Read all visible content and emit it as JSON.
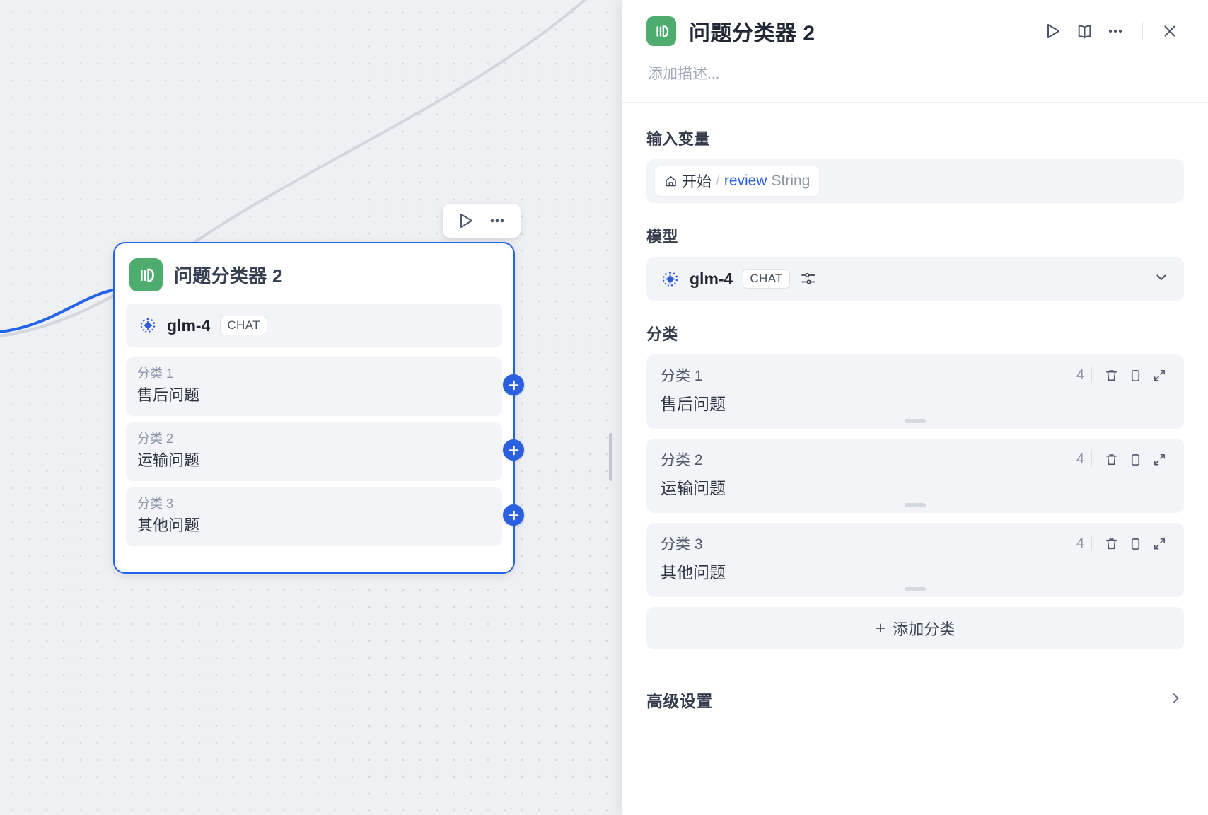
{
  "colors": {
    "accent_blue": "#2a5fe0",
    "node_selected_border": "#2563eb",
    "node_icon_green": "#4ead6e",
    "canvas_bg": "#eef0f4",
    "panel_bg": "#ffffff",
    "field_bg": "#f3f4f8",
    "var_blue": "#2a5fe0"
  },
  "canvas": {
    "toolbar": {
      "run_icon": "play-icon",
      "more_icon": "ellipsis-icon"
    },
    "node": {
      "icon": "question-classifier-icon",
      "title": "问题分类器 2",
      "model": {
        "logo_icon": "glm-logo-icon",
        "name": "glm-4",
        "badge": "CHAT"
      },
      "classes": [
        {
          "label": "分类 1",
          "value": "售后问题",
          "handle_icon": "plus-icon"
        },
        {
          "label": "分类 2",
          "value": "运输问题",
          "handle_icon": "plus-icon"
        },
        {
          "label": "分类 3",
          "value": "其他问题",
          "handle_icon": "plus-icon"
        }
      ]
    }
  },
  "panel": {
    "icon": "question-classifier-icon",
    "title": "问题分类器 2",
    "description_placeholder": "添加描述...",
    "actions": [
      {
        "name": "run-button",
        "icon": "play-icon"
      },
      {
        "name": "help-docs-button",
        "icon": "book-icon"
      },
      {
        "name": "more-options-button",
        "icon": "ellipsis-icon"
      },
      {
        "name": "close-panel-button",
        "icon": "close-icon"
      }
    ],
    "input_variables": {
      "section_title": "输入变量",
      "variable": {
        "node_icon": "home-icon",
        "node_name": "开始",
        "separator": "/",
        "var_name": "review",
        "var_type": "String"
      }
    },
    "model": {
      "section_title": "模型",
      "logo_icon": "glm-logo-icon",
      "name": "glm-4",
      "badge": "CHAT",
      "params_icon": "sliders-icon",
      "chevron_icon": "chevron-down-icon"
    },
    "classes": {
      "section_title": "分类",
      "items": [
        {
          "label": "分类 1",
          "value": "售后问题",
          "char_count": "4",
          "delete_icon": "trash-icon",
          "copy_icon": "copy-icon",
          "expand_icon": "expand-icon",
          "resize_handle": "resize-handle"
        },
        {
          "label": "分类 2",
          "value": "运输问题",
          "char_count": "4",
          "delete_icon": "trash-icon",
          "copy_icon": "copy-icon",
          "expand_icon": "expand-icon",
          "resize_handle": "resize-handle"
        },
        {
          "label": "分类 3",
          "value": "其他问题",
          "char_count": "4",
          "delete_icon": "trash-icon",
          "copy_icon": "copy-icon",
          "expand_icon": "expand-icon",
          "resize_handle": "resize-handle"
        }
      ],
      "add_label": "添加分类",
      "add_icon": "plus-icon"
    },
    "advanced": {
      "title": "高级设置",
      "chevron_icon": "chevron-right-icon"
    }
  }
}
